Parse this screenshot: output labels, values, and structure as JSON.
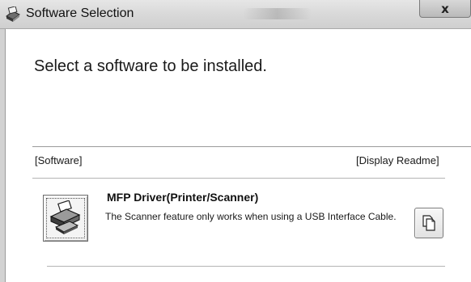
{
  "window": {
    "title": "Software Selection",
    "close_label": "x",
    "title_icon": "installer-app-icon",
    "close_icon": "close-icon"
  },
  "main": {
    "heading": "Select a software to be installed."
  },
  "list": {
    "columns": {
      "software": "[Software]",
      "readme": "[Display Readme]"
    },
    "items": [
      {
        "title": "MFP Driver(Printer/Scanner)",
        "description": "The Scanner feature only works when using a USB Interface Cable.",
        "install_icon": "printer-scanner-icon",
        "readme_icon": "document-copy-icon"
      }
    ]
  }
}
